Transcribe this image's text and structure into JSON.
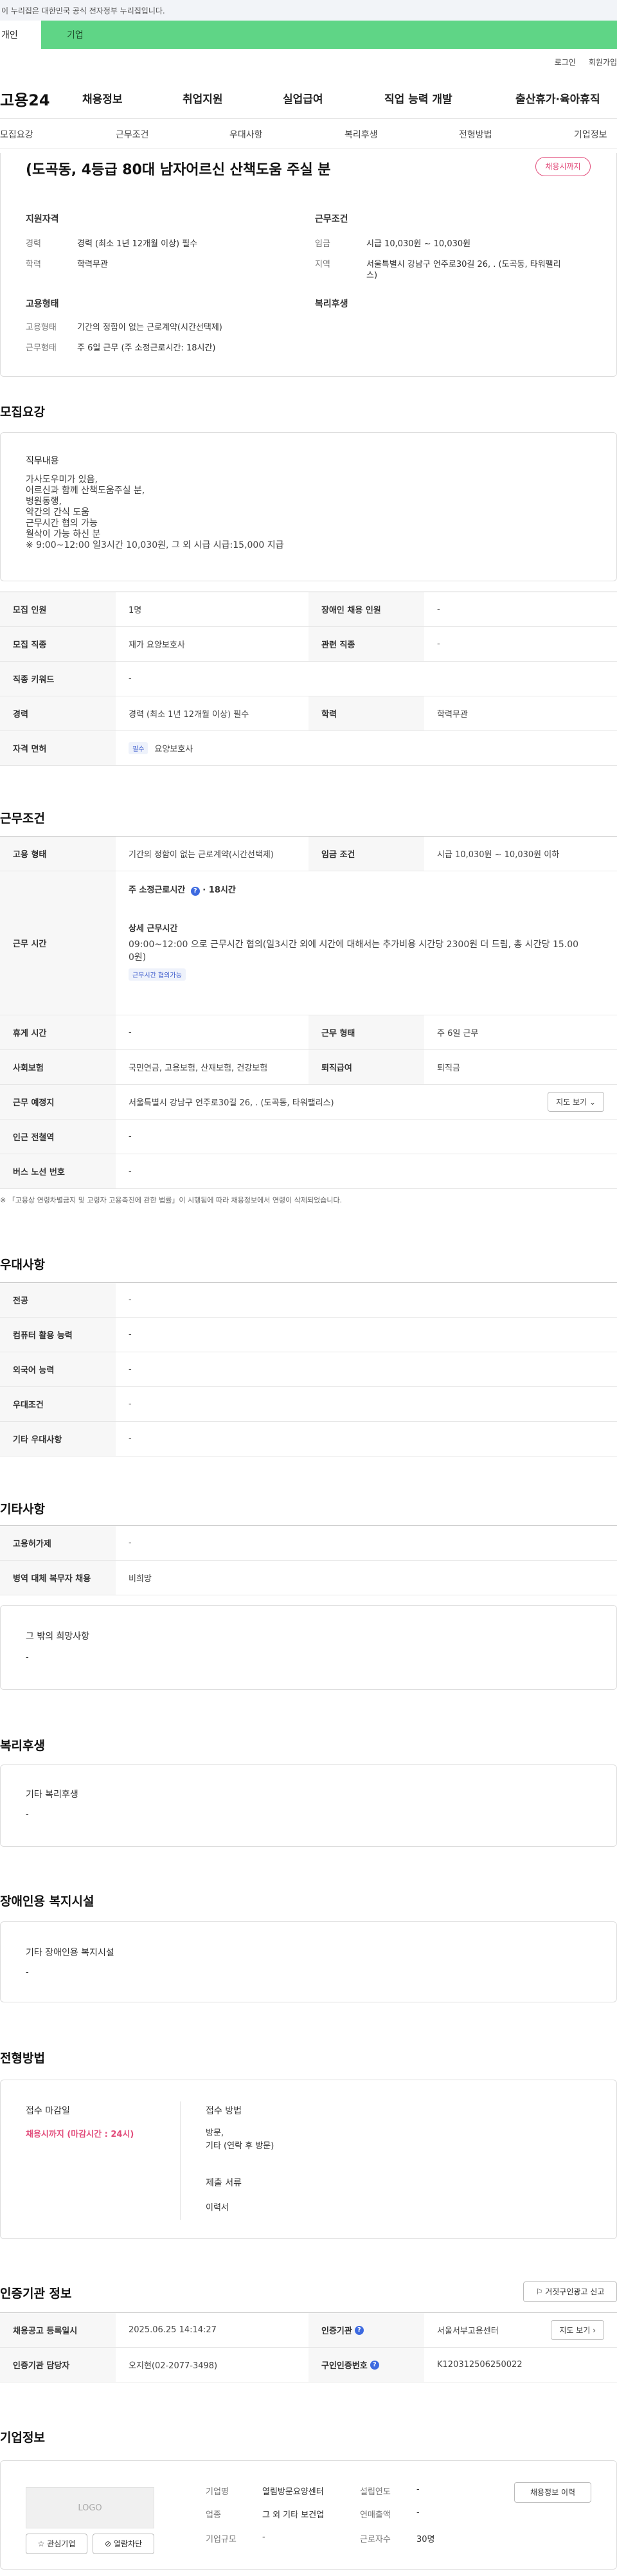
{
  "gov_bar": {
    "text": "이 누리집은 대한민국 공식 전자정부 누리집입니다."
  },
  "user_tabs": {
    "personal": "개인",
    "company": "기업"
  },
  "util": {
    "login": "로그인",
    "join": "회원가입"
  },
  "gnb": {
    "logo": "고용24",
    "items": [
      "채용정보",
      "취업지원",
      "실업급여",
      "직업 능력 개발",
      "출산휴가·육아휴직"
    ]
  },
  "tabnav": [
    "모집요강",
    "근무조건",
    "우대사항",
    "복리후생",
    "전형방법",
    "기업정보"
  ],
  "summary": {
    "title": "(도곡동, 4등급 80대 남자어르신 산책도움 주실 분",
    "badge": "채용시까지",
    "qual_head": "지원자격",
    "cond_head": "근무조건",
    "career_label": "경력",
    "career_value": "경력 (최소 1년 12개월 이상) 필수",
    "edu_label": "학력",
    "edu_value": "학력무관",
    "wage_label": "임금",
    "wage_value": "시급 10,030원 ~ 10,030원",
    "region_label": "지역",
    "region_value1": "서울특별시 강남구 언주로30길 26, . (도곡동, 타워팰리",
    "region_value2": "스)",
    "emp_head": "고용형태",
    "welfare_head": "복리후생",
    "emp_type_label": "고용형태",
    "emp_type_value": "기간의 정함이 없는 근로계약(시간선택제)",
    "work_type_label": "근무형태",
    "work_type_value": "주 6일 근무 (주 소정근로시간: 18시간)"
  },
  "recruit": {
    "section_title": "모집요강",
    "job_head": "직무내용",
    "job_lines": [
      "가사도우미가 있음,",
      "어르신과 함께 산책도움주실 분,",
      "병원동행,",
      "약간의 간식 도움",
      "근무시간 협의 가능",
      "월삭이 가능 하신 분",
      "※ 9:00~12:00 일3시간 10,030원, 그 외 시급 시급:15,000 지급"
    ],
    "rows": [
      {
        "l1": "모집 인원",
        "v1": "1명",
        "l2": "장애인 채용 인원",
        "v2": "-"
      },
      {
        "l1": "모집 직종",
        "v1": "재가 요양보호사",
        "l2": "관련 직종",
        "v2": "-"
      },
      {
        "l1": "직종 키워드",
        "v1": "-"
      },
      {
        "l1": "경력",
        "v1": "경력 (최소 1년 12개월 이상) 필수",
        "l2": "학력",
        "v2": "학력무관"
      },
      {
        "l1": "자격 면허",
        "pill": "필수",
        "v1": "요양보호사"
      }
    ]
  },
  "work": {
    "section_title": "근무조건",
    "emp_label": "고용 형태",
    "emp_value": "기간의 정함이 없는 근로계약(시간선택제)",
    "wage_label": "임금 조건",
    "wage_value": "시급 10,030원 ~ 10,030원 이하",
    "time_label": "근무 시간",
    "time_head1": "주 소정근로시간",
    "time_head1_value": "18시간",
    "time_head2": "상세 근무시간",
    "time_detail1": "09:00~12:00 으로 근무시간 협의(일3시간 외에 시간에 대해서는 추가비용 시간당 2300원 더 드림, 총 시간당 15.00",
    "time_detail2": "0원)",
    "time_badge": "근무시간 협의가능",
    "rest_label": "휴게 시간",
    "rest_value": "-",
    "worktype_label": "근무 형태",
    "worktype_value": "주 6일 근무",
    "insurance_label": "사회보험",
    "insurance_value": "국민연금, 고용보험, 산재보험, 건강보험",
    "retire_label": "퇴직급여",
    "retire_value": "퇴직금",
    "place_label": "근무 예정지",
    "place_value": "서울특별시 강남구 언주로30길 26, . (도곡동, 타워팰리스)",
    "map_btn": "지도 보기",
    "station_label": "인근 전철역",
    "station_value": "-",
    "bus_label": "버스 노선 번호",
    "bus_value": "-",
    "footnote": "※ 「고용상 연령차별금지 및 고령자 고용촉진에 관한 법률」이 시행됨에 따라 채용정보에서 연령이 삭제되었습니다."
  },
  "pref": {
    "section_title": "우대사항",
    "rows": [
      {
        "l": "전공",
        "v": "-"
      },
      {
        "l": "컴퓨터 활용 능력",
        "v": "-"
      },
      {
        "l": "외국어 능력",
        "v": "-"
      },
      {
        "l": "우대조건",
        "v": "-"
      },
      {
        "l": "기타 우대사항",
        "v": "-"
      }
    ]
  },
  "etc": {
    "section_title": "기타사항",
    "rows": [
      {
        "l": "고용허가제",
        "v": "-"
      },
      {
        "l": "병역 대체 복무자 채용",
        "v": "비희망"
      }
    ],
    "other_head": "그 밖의 희망사항",
    "other_value": "-"
  },
  "welfare": {
    "section_title": "복리후생",
    "head": "기타 복리후생",
    "value": "-"
  },
  "disabled": {
    "section_title": "장애인용 복지시설",
    "head": "기타 장애인용 복지시설",
    "value": "-"
  },
  "screening": {
    "section_title": "전형방법",
    "deadline_head": "접수 마감일",
    "deadline_value": "채용시까지 (마감시간 : 24시)",
    "method_head": "접수 방법",
    "method_value1": "방문,",
    "method_value2": "기타 (연락 후 방문)",
    "docs_head": "제출 서류",
    "docs_value": "이력서"
  },
  "cert": {
    "section_title": "인증기관 정보",
    "report_btn": "거짓구인광고 신고",
    "reg_label": "채용공고 등록일시",
    "reg_value": "2025.06.25 14:14:27",
    "org_label": "인증기관",
    "org_value": "서울서부고용센터",
    "map_btn": "지도 보기",
    "manager_label": "인증기관 담당자",
    "manager_value": "오지현(02-2077-3498)",
    "cert_no_label": "구인인증번호",
    "cert_no_value": "K120312506250022"
  },
  "company": {
    "section_title": "기업정보",
    "logo": "LOGO",
    "fav_btn": "관심기업",
    "block_btn": "열람차단",
    "name_label": "기업명",
    "name_value": "열림방문요양센터",
    "year_label": "설립연도",
    "year_value": "-",
    "industry_label": "업종",
    "industry_value": "그 외 기타 보건업",
    "sales_label": "연매출액",
    "sales_value": "-",
    "size_label": "기업규모",
    "size_value": "-",
    "staff_label": "근로자수",
    "staff_value": "30명",
    "info_btn": "채용정보 이력"
  }
}
